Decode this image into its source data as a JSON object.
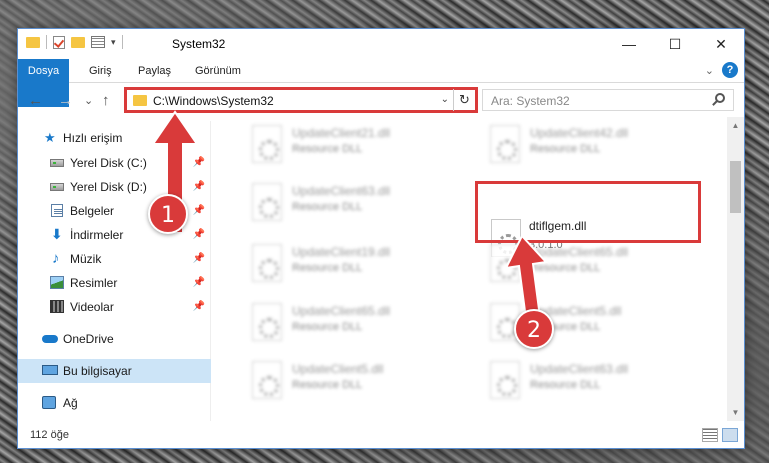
{
  "window": {
    "title": "System32",
    "minimize": "—",
    "maximize": "☐",
    "close": "✕"
  },
  "ribbon": {
    "tabs": [
      "Dosya",
      "Giriş",
      "Paylaş",
      "Görünüm"
    ],
    "expand": "⌄",
    "help": "?"
  },
  "nav": {
    "back": "←",
    "forward": "→",
    "recent": "⌄",
    "up": "↑",
    "address": "C:\\Windows\\System32",
    "address_dropdown": "⌄",
    "refresh": "↻",
    "search_placeholder": "Ara: System32"
  },
  "sidebar": {
    "items": [
      {
        "label": "Hızlı erişim",
        "icon": "star-icon"
      },
      {
        "label": "Yerel Disk (C:)",
        "icon": "disk-icon",
        "pinned": true
      },
      {
        "label": "Yerel Disk (D:)",
        "icon": "disk-icon",
        "pinned": true
      },
      {
        "label": "Belgeler",
        "icon": "documents-icon",
        "pinned": true
      },
      {
        "label": "İndirmeler",
        "icon": "download-icon",
        "pinned": true
      },
      {
        "label": "Müzik",
        "icon": "music-icon",
        "pinned": true
      },
      {
        "label": "Resimler",
        "icon": "pictures-icon",
        "pinned": true
      },
      {
        "label": "Videolar",
        "icon": "video-icon",
        "pinned": true
      },
      {
        "label": "OneDrive",
        "icon": "cloud-icon"
      },
      {
        "label": "Bu bilgisayar",
        "icon": "computer-icon",
        "selected": true
      },
      {
        "label": "Ağ",
        "icon": "network-icon"
      }
    ],
    "pin_glyph": "📌"
  },
  "files": [
    {
      "name": "UpdateClient21.dll",
      "type": "Resource DLL",
      "blurred": true
    },
    {
      "name": "UpdateClient42.dll",
      "type": "Resource DLL",
      "blurred": true
    },
    {
      "name": "UpdateClient63.dll",
      "type": "Resource DLL",
      "blurred": true
    },
    {
      "name": "dtiflgem.dll",
      "type": "3.0.1.0",
      "blurred": false,
      "highlighted": true
    },
    {
      "name": "UpdateClient19.dll",
      "type": "Resource DLL",
      "blurred": true
    },
    {
      "name": "UpdateClient65.dll",
      "type": "Resource DLL",
      "blurred": true
    },
    {
      "name": "UpdateClient65.dll",
      "type": "Resource DLL",
      "blurred": true
    },
    {
      "name": "UpdateClient5.dll",
      "type": "Resource DLL",
      "blurred": true
    },
    {
      "name": "UpdateClient5.dll",
      "type": "Resource DLL",
      "blurred": true
    },
    {
      "name": "UpdateClient63.dll",
      "type": "Resource DLL",
      "blurred": true
    }
  ],
  "status": {
    "count": "112 öğe"
  },
  "annotations": {
    "step1": "1",
    "step2": "2",
    "color": "#d93a3a"
  }
}
